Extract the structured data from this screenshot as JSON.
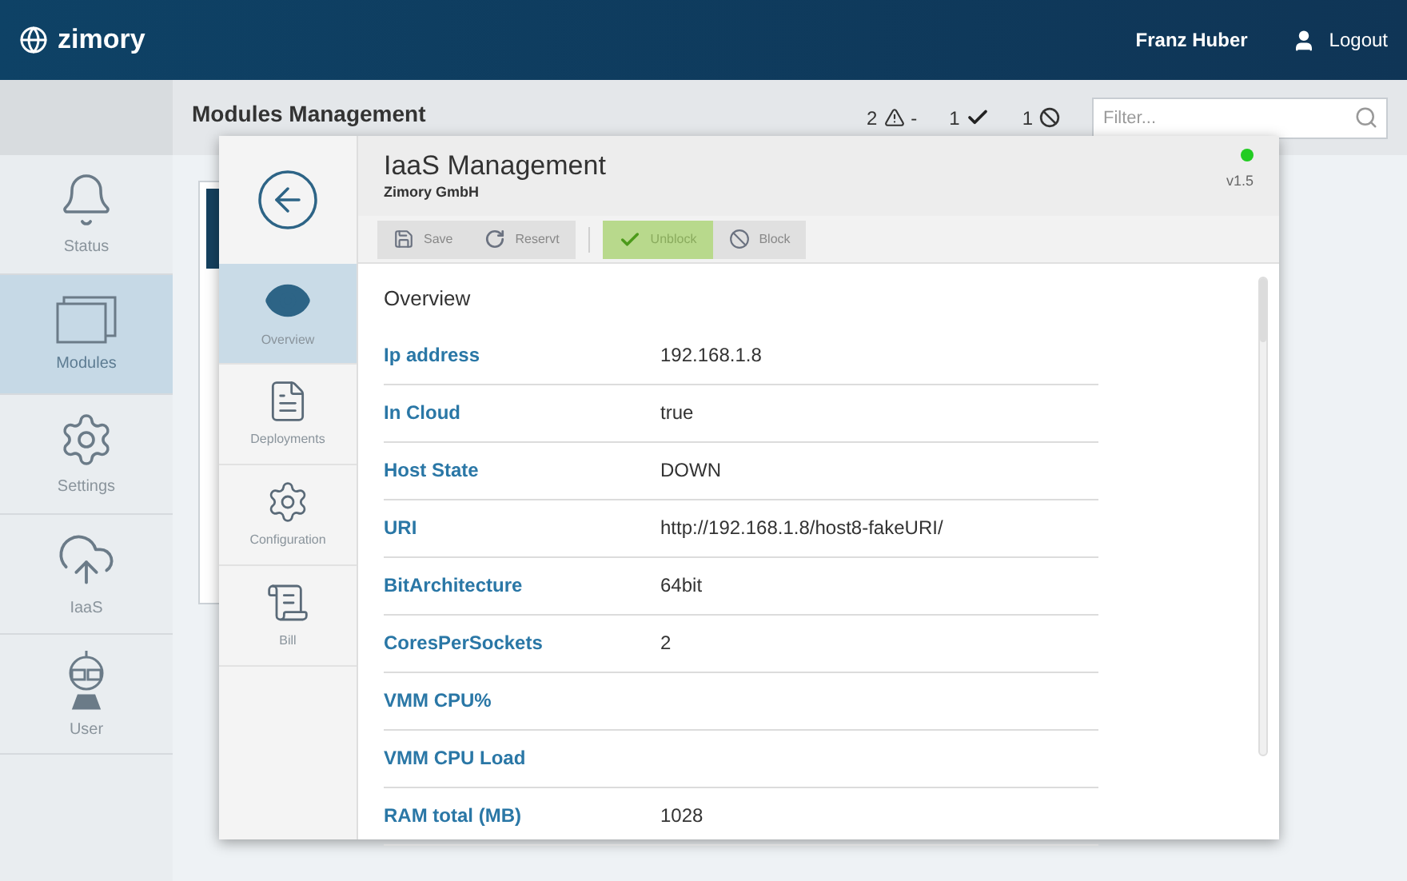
{
  "header": {
    "logo": "zimory",
    "user": "Franz Huber",
    "logout": "Logout"
  },
  "sidebar": {
    "items": [
      {
        "label": "Status",
        "kind": "bell",
        "selected": false
      },
      {
        "label": "Modules",
        "kind": "modules",
        "selected": true
      },
      {
        "label": "Settings",
        "kind": "gear",
        "selected": false
      },
      {
        "label": "IaaS",
        "kind": "cloud",
        "selected": false
      },
      {
        "label": "User",
        "kind": "user",
        "selected": false
      }
    ]
  },
  "subheader": {
    "title": "Modules Management",
    "counters": [
      {
        "kind": "warning",
        "count": "2",
        "suffix": "-"
      },
      {
        "kind": "ok",
        "count": "1"
      },
      {
        "kind": "blocked",
        "count": "1"
      }
    ],
    "filter": {
      "placeholder": "Filter..."
    }
  },
  "modal": {
    "title": "IaaS Management",
    "subtitle": "Zimory GmbH",
    "online": true,
    "version": "v1.5",
    "nav": [
      {
        "label": "Overview",
        "kind": "eye",
        "selected": true
      },
      {
        "label": "Deployments",
        "kind": "list",
        "selected": false
      },
      {
        "label": "Configuration",
        "kind": "gear",
        "selected": false
      },
      {
        "label": "Bill",
        "kind": "bill",
        "selected": false
      }
    ],
    "toolbar": [
      [
        {
          "label": "Save",
          "kind": "save",
          "active": false
        },
        {
          "label": "Reservt",
          "kind": "reload",
          "active": false
        }
      ],
      [
        {
          "label": "Unblock",
          "kind": "check",
          "active": true
        },
        {
          "label": "Block",
          "kind": "ban",
          "active": false
        }
      ]
    ],
    "section": "Overview",
    "rows": [
      {
        "label": "Ip address",
        "value": "192.168.1.8"
      },
      {
        "label": "In Cloud",
        "value": "true"
      },
      {
        "label": "Host State",
        "value": "DOWN"
      },
      {
        "label": "URI",
        "value": "http://192.168.1.8/host8-fakeURI/"
      },
      {
        "label": "BitArchitecture",
        "value": "64bit"
      },
      {
        "label": "CoresPerSockets",
        "value": "2"
      },
      {
        "label": "VMM CPU%"
      },
      {
        "label": "VMM CPU Load"
      },
      {
        "label": "RAM total (MB)",
        "value": "1028"
      }
    ]
  }
}
